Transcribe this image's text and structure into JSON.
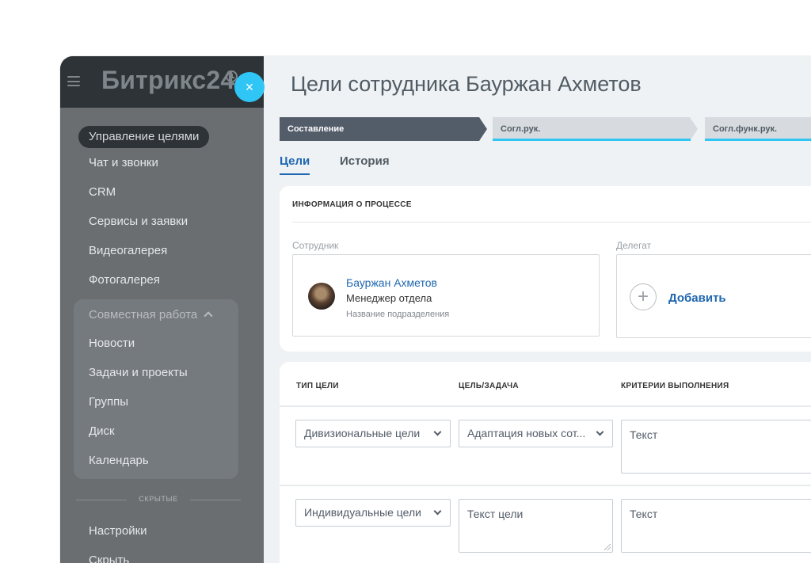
{
  "sidebar": {
    "logo": "Битрикс24",
    "close_symbol": "×",
    "items": [
      {
        "label": "Управление целями",
        "active": true
      },
      {
        "label": "Чат и звонки"
      },
      {
        "label": "CRM"
      },
      {
        "label": "Сервисы и заявки"
      },
      {
        "label": "Видеогалерея"
      },
      {
        "label": "Фотогалерея"
      }
    ],
    "group": {
      "title": "Совместная работа",
      "items": [
        "Новости",
        "Задачи и проекты",
        "Группы",
        "Диск",
        "Календарь"
      ]
    },
    "hidden_label": "СКРЫТЫЕ",
    "bottom_items": [
      "Настройки",
      "Скрыть"
    ]
  },
  "main": {
    "title": "Цели сотрудника Бауржан Ахметов",
    "stages": [
      "Составление",
      "Согл.рук.",
      "Согл.функ.рук."
    ],
    "tabs": [
      "Цели",
      "История"
    ],
    "process_info": {
      "title": "ИНФОРМАЦИЯ О ПРОЦЕССЕ",
      "employee_label": "Сотрудник",
      "employee": {
        "name": "Бауржан Ахметов",
        "position": "Менеджер отдела",
        "department": "Название подразделения"
      },
      "delegate_label": "Делегат",
      "add_label": "Добавить",
      "plus_symbol": "+"
    },
    "goals_table": {
      "columns": [
        "ТИП ЦЕЛИ",
        "ЦЕЛЬ/ЗАДАЧА",
        "КРИТЕРИИ ВЫПОЛНЕНИЯ"
      ],
      "rows": [
        {
          "type": "Дивизиональные цели",
          "goal": "Адаптация новых сот...",
          "criteria": "Текст"
        },
        {
          "type": "Индивидуальные цели",
          "goal": "Текст цели",
          "criteria": "Текст"
        }
      ]
    }
  },
  "colors": {
    "sidebar_bg": "#6a6e71",
    "sidebar_header_bg": "#2e3337",
    "accent_blue": "#2fc6f6",
    "link_blue": "#2067b0",
    "active_stage": "#535c69",
    "main_bg": "#eef2f4"
  }
}
